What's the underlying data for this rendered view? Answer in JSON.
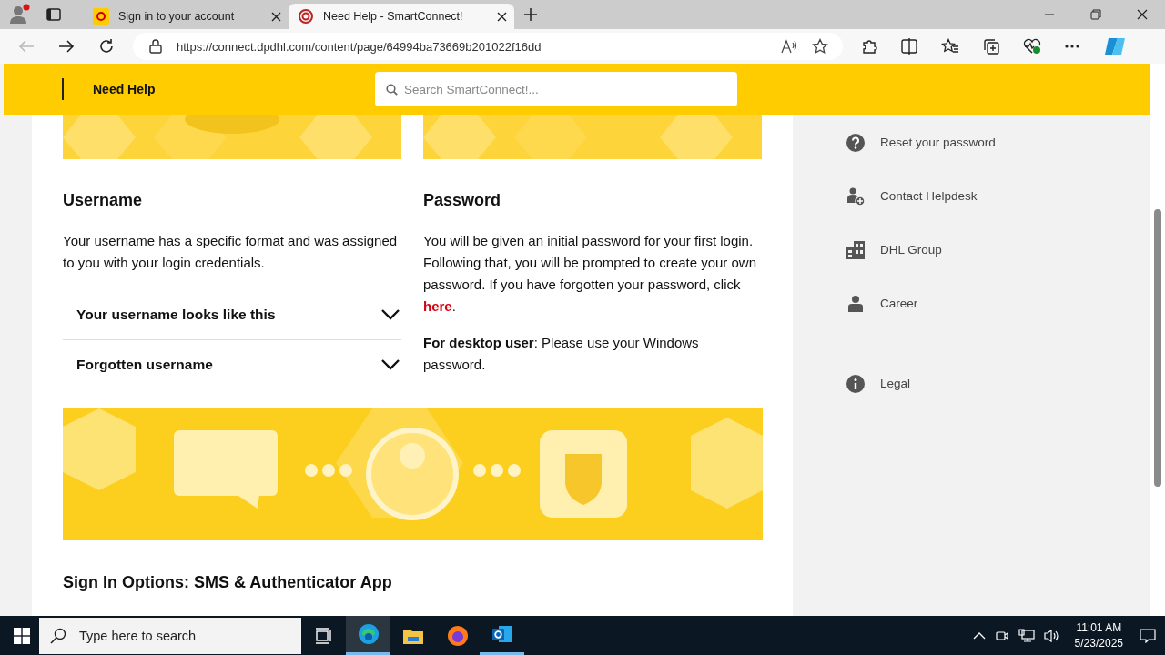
{
  "browser": {
    "tabs": [
      {
        "title": "Sign in to your account",
        "selected": false
      },
      {
        "title": "Need Help - SmartConnect!",
        "selected": true
      }
    ],
    "url": "https://connect.dpdhl.com/content/page/64994ba73669b201022f16dd"
  },
  "header": {
    "title": "Need Help",
    "search": {
      "placeholder": "Search SmartConnect!..."
    }
  },
  "sections": [
    {
      "heading": "Username",
      "text": "Your username has a specific format and was assigned to you with your login credentials.",
      "accordion": [
        {
          "label": "Your username looks like this",
          "expanded": false
        },
        {
          "label": "Forgotten username",
          "expanded": false
        }
      ]
    },
    {
      "heading": "Password",
      "text": "You will be given an initial password for your first login. Following that, you will be prompted to create your own password. If you have forgotten your password, click ",
      "link": "here",
      "link_after": ".",
      "note": "**For desktop user**: Please use your Windows password."
    }
  ],
  "next_heading": "Sign In Options: SMS & Authenticator App",
  "sidebar": [
    {
      "label": "Reset your password",
      "kind": "question"
    },
    {
      "label": "Contact Helpdesk",
      "kind": "person-plus"
    },
    {
      "label": "DHL Group",
      "kind": "building"
    },
    {
      "label": "Career",
      "kind": "person"
    },
    {
      "label": "Legal",
      "kind": "info"
    }
  ],
  "taskbar": {
    "search": {
      "placeholder": "Type here to search"
    },
    "time": "11:01 AM",
    "date": "5/23/2025"
  }
}
